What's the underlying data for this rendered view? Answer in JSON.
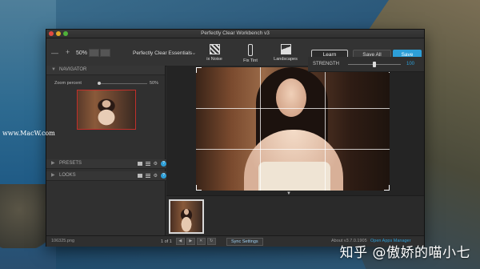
{
  "desktop": {
    "watermark": "www.MacW.com",
    "zh_watermark": "知乎 @傲娇的喵小七"
  },
  "window": {
    "title": "Perfectly Clear Workbench v3"
  },
  "toolbar": {
    "zoom_minus": "—",
    "zoom_plus": "+",
    "zoom_value": "50%",
    "preset": "Perfectly Clear Essentials",
    "tools": [
      {
        "label": "ix Noise",
        "icon": "noise-icon"
      },
      {
        "label": "Fix Tint",
        "icon": "tint-icon"
      },
      {
        "label": "Landscapes",
        "icon": "landscape-icon"
      }
    ],
    "learn_label": "Learn",
    "save_all_label": "Save All",
    "save_label": "Save"
  },
  "navigator": {
    "title": "NAVIGATOR",
    "zoom_label": "Zoom percent",
    "zoom_value": "50%",
    "zoom_fraction": 0.0
  },
  "panels": {
    "presets_title": "PRESETS",
    "looks_title": "LOOKS",
    "help": "?"
  },
  "adjust": {
    "strength_label": "STRENGTH",
    "strength_value": "100",
    "strength_fraction": 0.5
  },
  "status": {
    "file": "106325.png",
    "page": "1 of 1",
    "sync": "Sync Settings",
    "about": "About v3.7.0.1905",
    "manager": "Open Apps Manager"
  },
  "accent": "#2d9fd8"
}
